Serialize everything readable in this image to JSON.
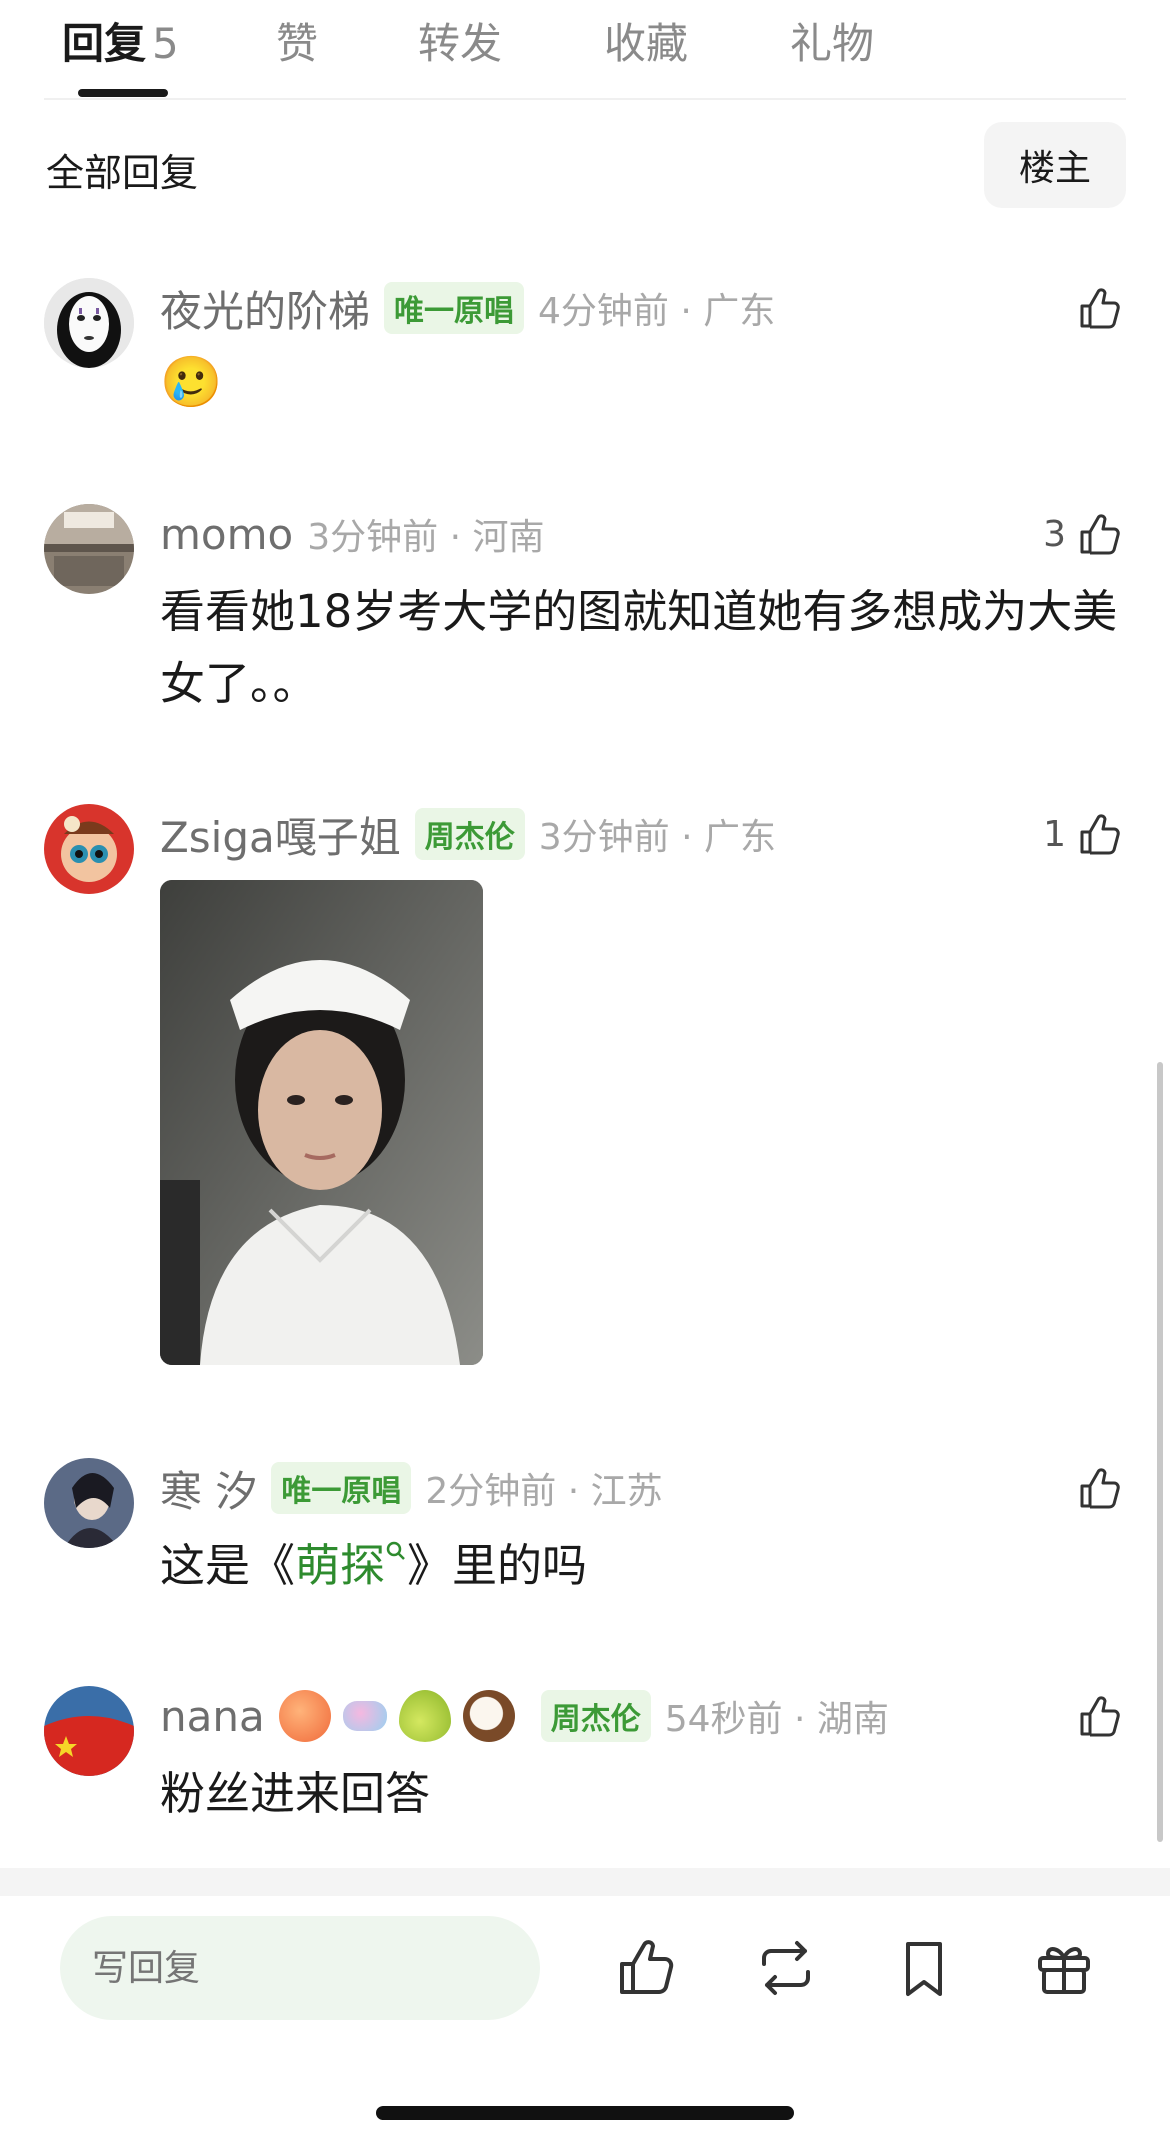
{
  "tabs": [
    {
      "label": "回复",
      "count": "5"
    },
    {
      "label": "赞"
    },
    {
      "label": "转发"
    },
    {
      "label": "收藏"
    },
    {
      "label": "礼物"
    }
  ],
  "section": {
    "title": "全部回复",
    "owner_button": "楼主"
  },
  "comments": [
    {
      "username": "夜光的阶梯",
      "badge": "唯一原唱",
      "time": "4分钟前 · 广东",
      "likes": "",
      "text": "🥲"
    },
    {
      "username": "momo",
      "badge": "",
      "time": "3分钟前 · 河南",
      "likes": "3",
      "text": "看看她18岁考大学的图就知道她有多想成为大美女了。。"
    },
    {
      "username": "Zsiga嘎子姐",
      "badge": "周杰伦",
      "time": "3分钟前 · 广东",
      "likes": "1",
      "text": ""
    },
    {
      "username": "寒 汐",
      "badge": "唯一原唱",
      "time": "2分钟前 · 江苏",
      "likes": "",
      "text_prefix": "这是《",
      "link": "萌探",
      "text_suffix": "》里的吗"
    },
    {
      "username": "nana",
      "badge": "周杰伦",
      "time": "54秒前 · 湖南",
      "likes": "",
      "text": "粉丝进来回答"
    }
  ],
  "reply": {
    "placeholder": "写回复"
  },
  "icons": {
    "like": "thumbs-up-icon",
    "repost": "repost-icon",
    "bookmark": "bookmark-icon",
    "gift": "gift-icon",
    "search": "search-icon"
  },
  "colors": {
    "badge_green": "#3c9a36",
    "badge_bg": "#eaf6e6",
    "link_green": "#2e8b2e",
    "input_bg": "#eef6ee"
  }
}
